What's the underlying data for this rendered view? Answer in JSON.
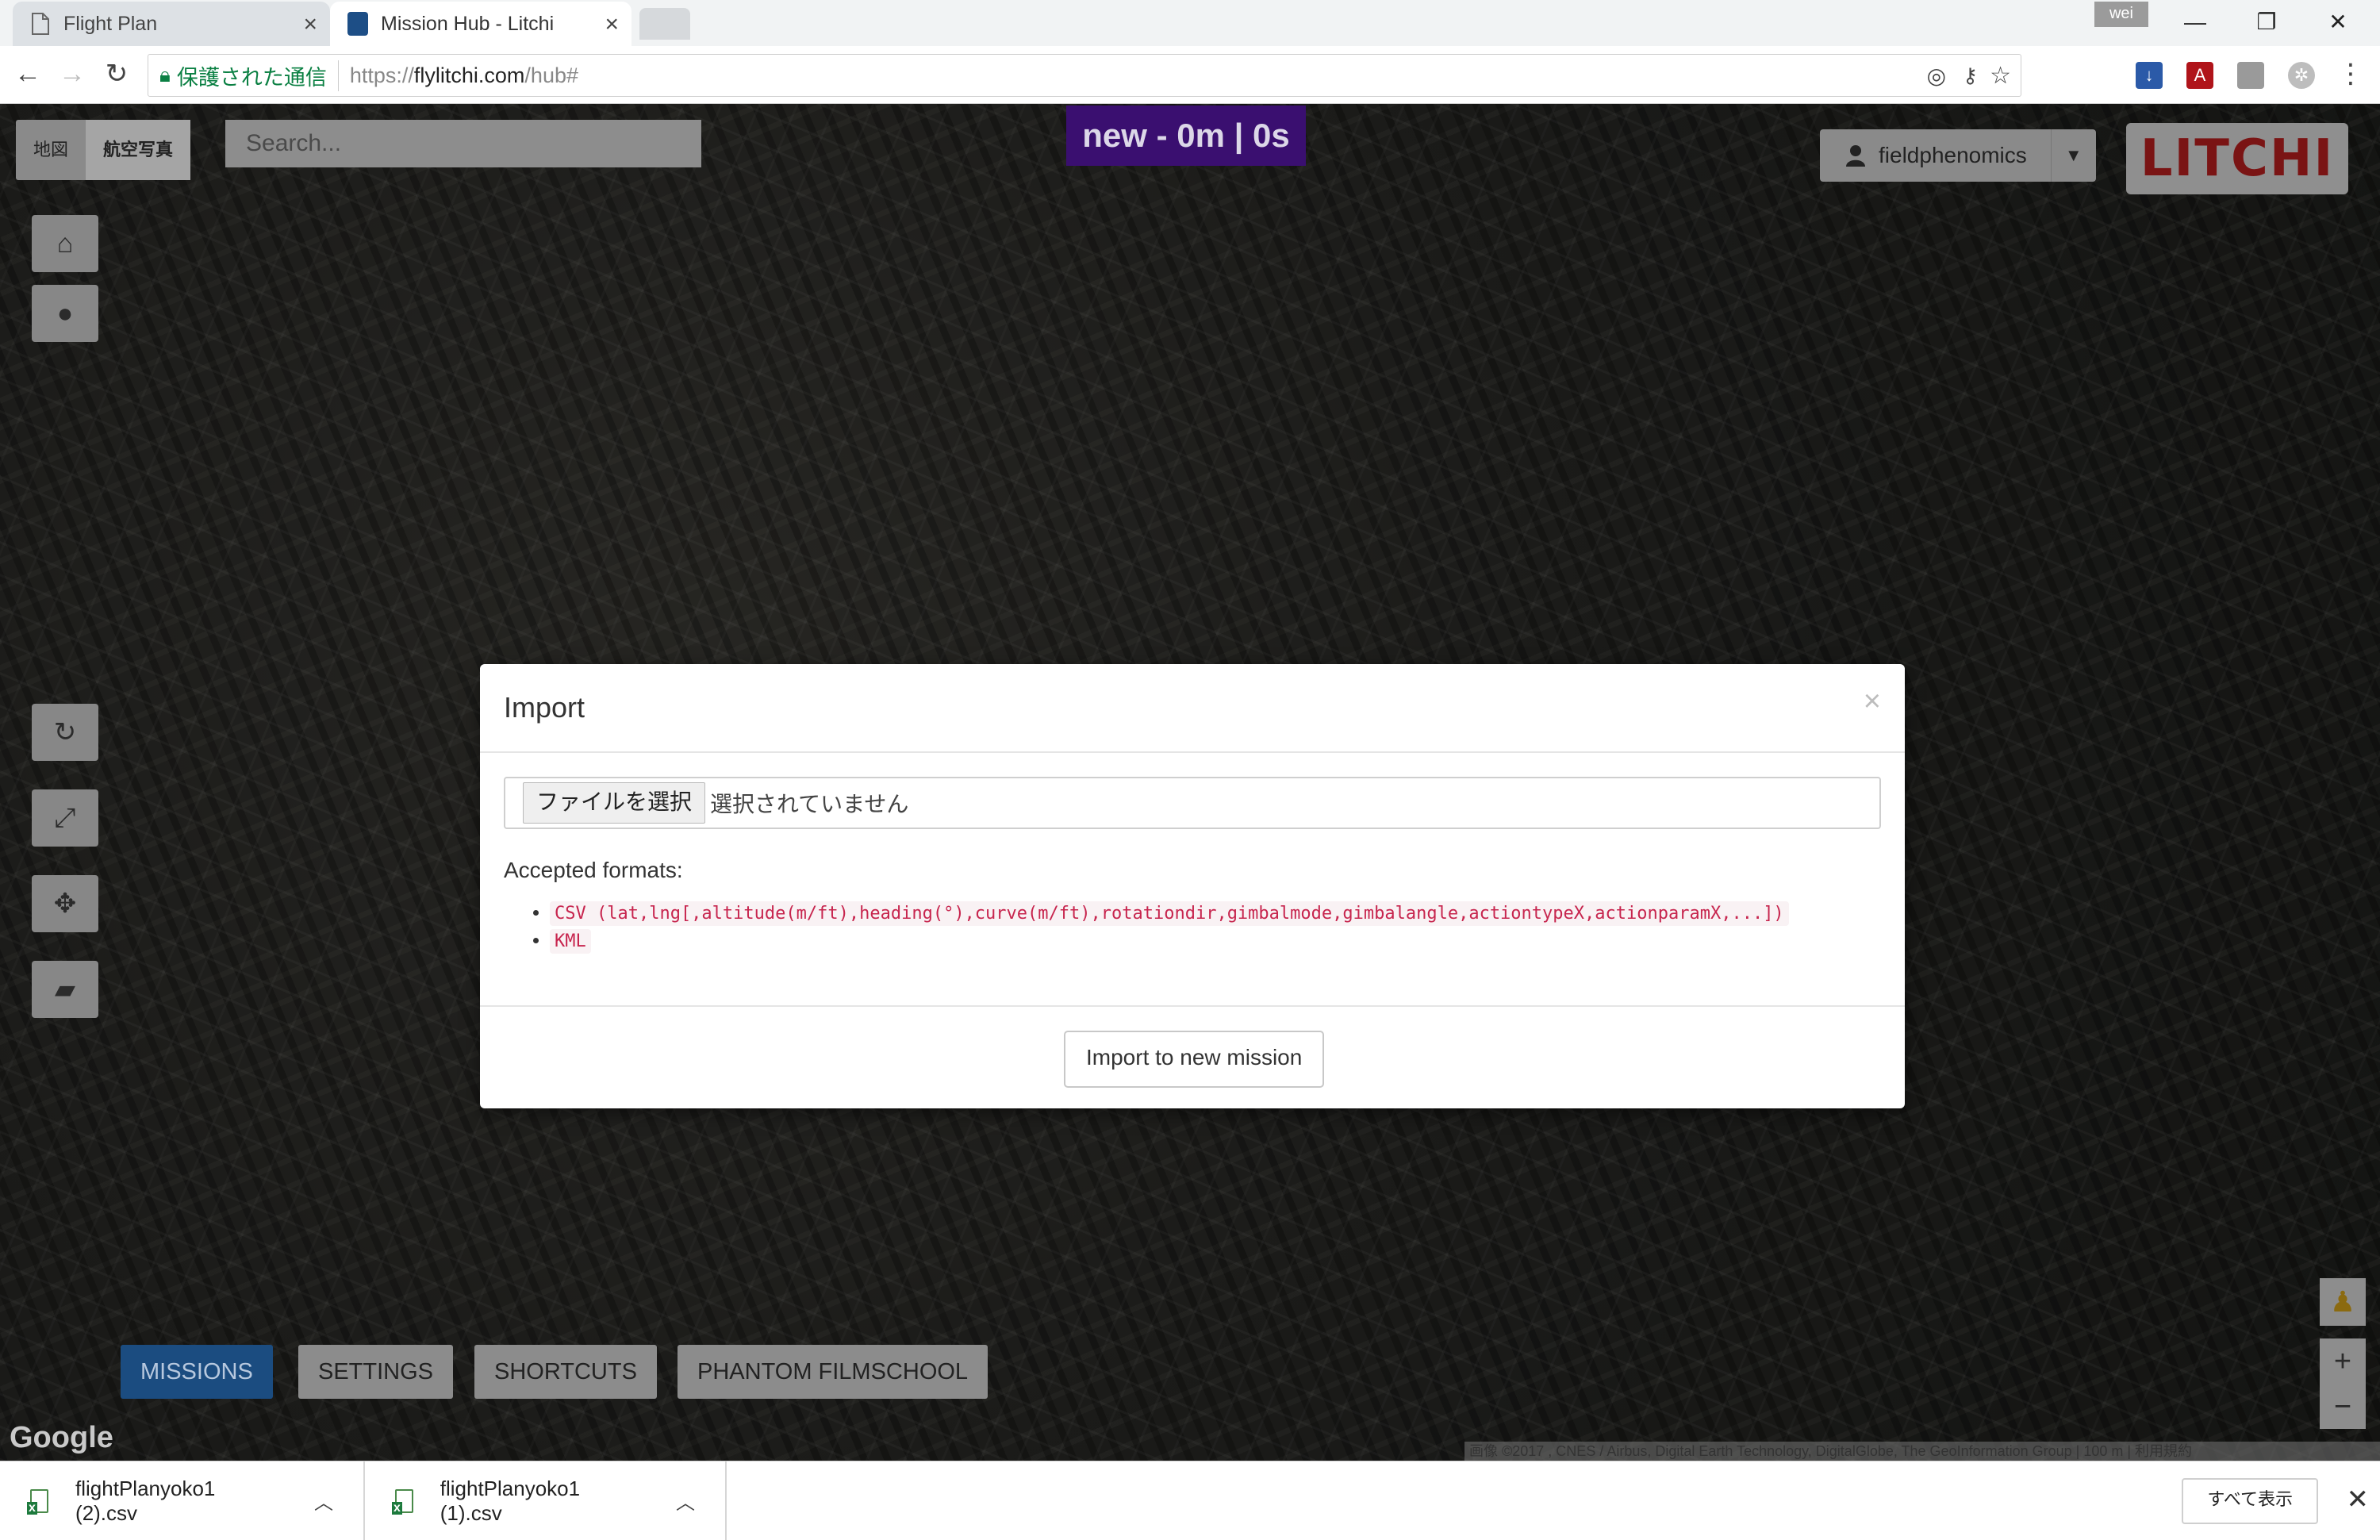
{
  "browser": {
    "tabs": [
      {
        "title": "Flight Plan",
        "close": "×"
      },
      {
        "title": "Mission Hub - Litchi",
        "close": "×"
      }
    ],
    "profile_chip": "wei",
    "window_controls": {
      "minimize": "—",
      "restore": "❐",
      "close": "✕"
    },
    "nav": {
      "back": "←",
      "forward": "→",
      "reload": "↻"
    },
    "address": {
      "secure_label": "保護された通信",
      "url_scheme": "https://",
      "url_host": "flylitchi.com",
      "url_path": "/hub#"
    },
    "omnibox_icons": [
      "location-icon",
      "key-icon",
      "star-icon"
    ],
    "extensions": [
      "download-extension-icon",
      "pdf-extension-icon",
      "extension-icon",
      "settings-extension-icon"
    ],
    "menu_glyph": "⋮"
  },
  "map": {
    "map_types": [
      "地図",
      "航空写真"
    ],
    "search_placeholder": "Search...",
    "mission_status": "new - 0m | 0s",
    "user": {
      "name": "fieldphenomics"
    },
    "logo_text": "LITCHI",
    "side_tools": [
      {
        "icon": "home-icon",
        "glyph": "⌂"
      },
      {
        "icon": "globe-icon",
        "glyph": "●"
      },
      {
        "icon": "refresh-icon",
        "glyph": "↻"
      },
      {
        "icon": "expand-icon",
        "glyph": "⤢"
      },
      {
        "icon": "move-icon",
        "glyph": "✥"
      },
      {
        "icon": "eraser-icon",
        "glyph": "▰"
      }
    ],
    "bottom_tabs": [
      "MISSIONS",
      "SETTINGS",
      "SHORTCUTS",
      "PHANTOM FILMSCHOOL"
    ],
    "google_logo": "Google",
    "attribution": "画像 ©2017 , CNES / Airbus, Digital Earth Technology, DigitalGlobe, The GeoInformation Group  |  100 m  |  利用規約",
    "zoom": {
      "in": "+",
      "out": "−"
    }
  },
  "modal": {
    "title": "Import",
    "close": "×",
    "file_button": "ファイルを選択",
    "file_status": "選択されていません",
    "formats_label": "Accepted formats:",
    "formats": [
      "CSV (lat,lng[,altitude(m/ft),heading(°),curve(m/ft),rotationdir,gimbalmode,gimbalangle,actiontypeX,actionparamX,...])",
      "KML"
    ],
    "import_button": "Import to new mission"
  },
  "downloads": {
    "items": [
      {
        "name": "flightPlanyoko1 (2).csv"
      },
      {
        "name": "flightPlanyoko1 (1).csv"
      }
    ],
    "show_all": "すべて表示",
    "close": "✕"
  },
  "colors": {
    "mission_status_bg": "#3a0f70",
    "active_tab_bg": "#1b4c80",
    "logo_red": "#7a1414",
    "secure_green": "#0b8043",
    "code_pink": "#c7254e"
  }
}
